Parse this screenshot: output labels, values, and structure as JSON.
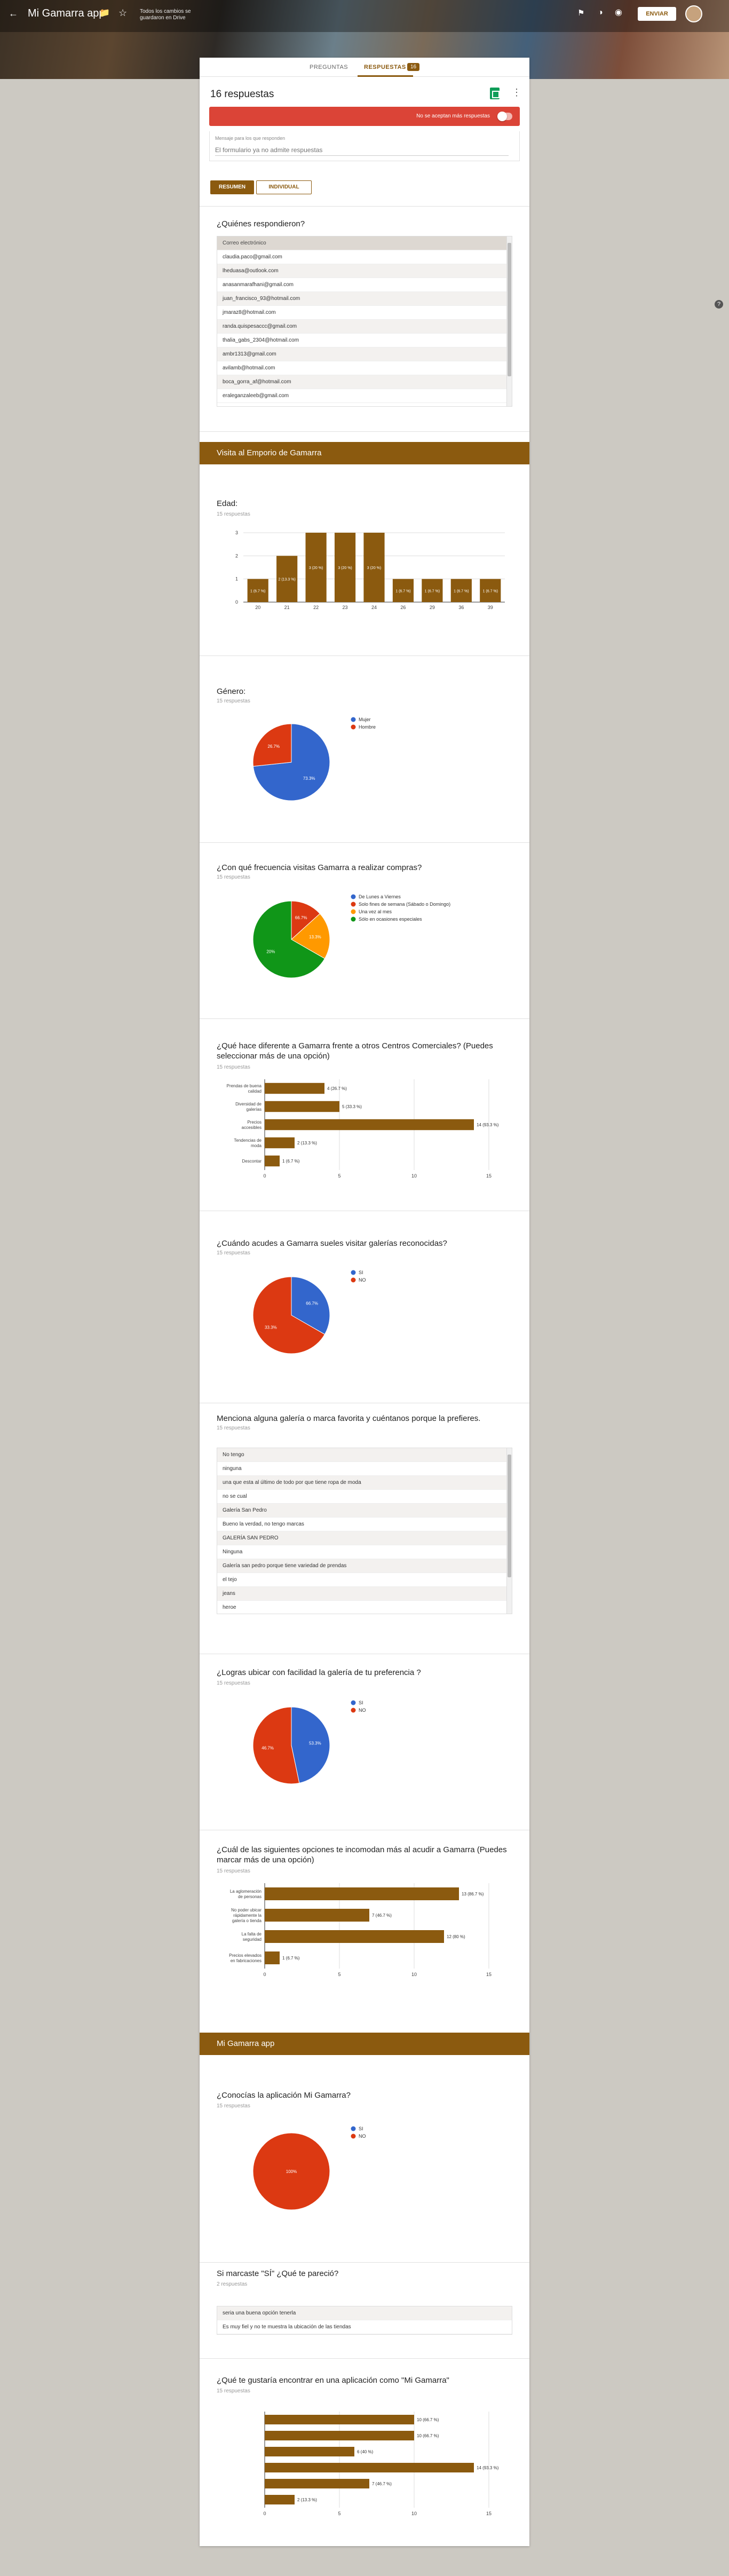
{
  "app": {
    "title": "Mi Gamarra app",
    "save_status": "Todos los cambios se guardaron en Drive",
    "send_label": "ENVIAR"
  },
  "tabs": {
    "questions": "PREGUNTAS",
    "responses": "RESPUESTAS",
    "responses_badge": "16"
  },
  "summary": {
    "count_label": "16 respuestas",
    "accepting_label": "No se aceptan más respuestas",
    "message_label": "Mensaje para los que responden",
    "message_placeholder": "El formulario ya no admite respuestas",
    "btn_summary": "RESUMEN",
    "btn_individual": "INDIVIDUAL"
  },
  "who": {
    "title": "¿Quiénes respondieron?",
    "header": "Correo electrónico",
    "emails": [
      "claudia.paco@gmail.com",
      "lheduasa@outlook.com",
      "anasanmarafhani@gmail.com",
      "juan_francisco_93@hotmail.com",
      "jmaraz8@hotmail.com",
      "randa.quispesaccc@gmail.com",
      "thalia_gabs_2304@hotmail.com",
      "ambr1313@gmail.com",
      "avilamb@hotmail.com",
      "boca_gorra_af@hotmail.com",
      "eraleganzaleeb@gmail.com"
    ]
  },
  "sections": {
    "visita": "Visita al Emporio de Gamarra",
    "app": "Mi Gamarra app"
  },
  "charts": {
    "edad": {
      "title": "Edad:",
      "sub": "15 respuestas",
      "chart_data": {
        "type": "bar",
        "categories": [
          "20",
          "21",
          "22",
          "23",
          "24",
          "26",
          "29",
          "36",
          "39"
        ],
        "values": [
          1,
          2,
          3,
          3,
          3,
          1,
          1,
          1,
          1
        ],
        "labels": [
          "1 (6.7 %)",
          "2 (13.3 %)",
          "3 (20 %)",
          "3 (20 %)",
          "3 (20 %)",
          "1 (6.7 %)",
          "1 (6.7 %)",
          "1 (6.7 %)",
          "1 (6.7 %)"
        ],
        "yticks": [
          "0",
          "1",
          "2",
          "3"
        ],
        "ylim": [
          0,
          3
        ]
      }
    },
    "genero": {
      "title": "Género:",
      "sub": "15 respuestas",
      "chart_data": {
        "type": "pie",
        "series": [
          {
            "name": "Mujer",
            "value": 73.3,
            "color": "#3366cc"
          },
          {
            "name": "Hombre",
            "value": 26.7,
            "color": "#dc3912"
          }
        ],
        "labels": [
          "73.3%",
          "26.7%"
        ]
      }
    },
    "frecuencia": {
      "title": "¿Con qué frecuencia visitas Gamarra a realizar compras?",
      "sub": "15 respuestas",
      "chart_data": {
        "type": "pie",
        "series": [
          {
            "name": "De Lunes a Viernes",
            "value": 0,
            "color": "#3366cc"
          },
          {
            "name": "Solo fines de semana (Sábado o Domingo)",
            "value": 13.3,
            "color": "#dc3912"
          },
          {
            "name": "Una vez al mes",
            "value": 20,
            "color": "#ff9900"
          },
          {
            "name": "Sólo en ocasiones especiales",
            "value": 66.7,
            "color": "#109618"
          }
        ],
        "labels": [
          "66.7%",
          "13.3%",
          "20%"
        ]
      }
    },
    "diferente": {
      "title": "¿Qué hace diferente a Gamarra frente a otros Centros Comerciales? (Puedes seleccionar más de una opción)",
      "sub": "15 respuestas",
      "chart_data": {
        "type": "bar",
        "orientation": "horizontal",
        "categories": [
          "Prendas de buena calidad",
          "Diversidad de galerías",
          "Precios accesibles",
          "Tendencias de moda",
          "Descontar"
        ],
        "values": [
          4,
          5,
          14,
          2,
          1
        ],
        "labels": [
          "4 (26.7 %)",
          "5 (33.3 %)",
          "14 (93.3 %)",
          "2 (13.3 %)",
          "1 (6.7 %)"
        ],
        "xticks": [
          "0",
          "5",
          "10",
          "15"
        ],
        "xlim": [
          0,
          15
        ]
      }
    },
    "cuando": {
      "title": "¿Cuándo acudes a Gamarra sueles visitar galerías reconocidas?",
      "sub": "15 respuestas",
      "chart_data": {
        "type": "pie",
        "series": [
          {
            "name": "SI",
            "value": 33.3,
            "color": "#3366cc"
          },
          {
            "name": "NO",
            "value": 66.7,
            "color": "#dc3912"
          }
        ],
        "labels": [
          "66.7%",
          "33.3%"
        ]
      }
    },
    "logras": {
      "title": "¿Logras ubicar con facilidad la galería de tu preferencia ?",
      "sub": "15 respuestas",
      "chart_data": {
        "type": "pie",
        "series": [
          {
            "name": "SI",
            "value": 46.7,
            "color": "#3366cc"
          },
          {
            "name": "NO",
            "value": 53.3,
            "color": "#dc3912"
          }
        ],
        "labels": [
          "53.3%",
          "46.7%"
        ]
      }
    },
    "incomodan": {
      "title": "¿Cuál de las siguientes opciones te incomodan más al acudir a Gamarra (Puedes marcar más de una opción)",
      "sub": "15 respuestas",
      "chart_data": {
        "type": "bar",
        "orientation": "horizontal",
        "categories": [
          "La aglomeración de personas",
          "No poder ubicar rápidamente la galería o tienda",
          "La falta de seguridad",
          "Precios elevados en fabricaciones"
        ],
        "values": [
          13,
          7,
          12,
          1
        ],
        "labels": [
          "13 (86.7 %)",
          "7 (46.7 %)",
          "12 (80 %)",
          "1 (6.7 %)"
        ],
        "xticks": [
          "0",
          "5",
          "10",
          "15"
        ],
        "xlim": [
          0,
          15
        ]
      }
    },
    "conocias": {
      "title": "¿Conocías la aplicación Mi Gamarra?",
      "sub": "15 respuestas",
      "chart_data": {
        "type": "pie",
        "series": [
          {
            "name": "SI",
            "value": 0,
            "color": "#3366cc"
          },
          {
            "name": "NO",
            "value": 100,
            "color": "#dc3912"
          }
        ],
        "labels": [
          "100%"
        ]
      }
    },
    "gustaria": {
      "title": "¿Qué te gustaría encontrar en una aplicación como \"Mi Gamarra\"",
      "sub": "15 respuestas",
      "chart_data": {
        "type": "bar",
        "orientation": "horizontal",
        "categories": [
          "",
          "",
          "",
          "",
          "",
          ""
        ],
        "values": [
          10,
          10,
          6,
          14,
          7,
          2
        ],
        "labels": [
          "10 (66.7 %)",
          "10 (66.7 %)",
          "6 (40 %)",
          "14 (93.3 %)",
          "7 (46.7 %)",
          "2 (13.3 %)"
        ],
        "xticks": [
          "0",
          "5",
          "10",
          "15"
        ],
        "xlim": [
          0,
          15
        ]
      }
    }
  },
  "menciona": {
    "title": "Menciona alguna galería o marca favorita y cuéntanos porque la prefieres.",
    "sub": "15 respuestas",
    "answers": [
      "No tengo",
      "ninguna",
      "una que esta al último de todo por que tiene ropa de moda",
      "no se cual",
      "Galería San Pedro",
      "Bueno la verdad, no tengo marcas",
      "GALERÍA SAN PEDRO",
      "Ninguna",
      "Galería san pedro porque tiene variedad de prendas",
      "el tejo",
      "jeans",
      "heroe"
    ]
  },
  "marcaste": {
    "title": "Si marcaste \"SÍ\" ¿Qué te pareció?",
    "sub": "2 respuestas",
    "answers": [
      "seria una buena opción tenerla",
      "Es muy fiel y no te muestra la ubicación de las tiendas"
    ]
  }
}
